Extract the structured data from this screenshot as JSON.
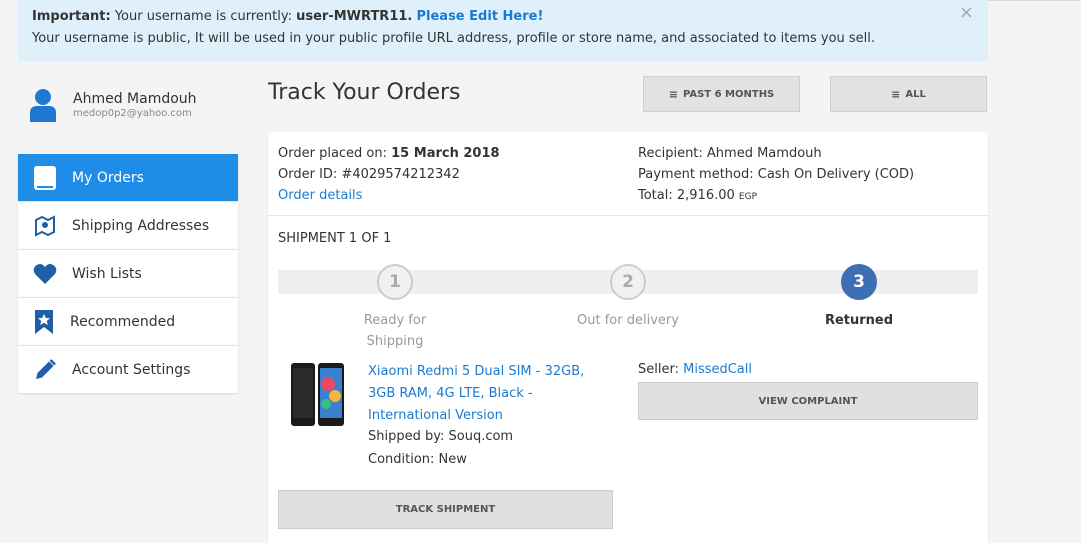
{
  "alert": {
    "important_label": "Important:",
    "text1": " Your username is currently: ",
    "username": "user-MWRTR11.",
    "edit_link": "Please Edit Here!",
    "line2": "Your username is public, It will be used in your public profile URL address, profile or store name, and associated to items you sell.",
    "close_symbol": "×"
  },
  "user": {
    "name": "Ahmed Mamdouh",
    "email": "medop0p2@yahoo.com",
    "avatar_icon": "user-icon"
  },
  "sidebar": {
    "items": [
      {
        "label": "My Orders",
        "icon": "book-icon",
        "active": true
      },
      {
        "label": "Shipping Addresses",
        "icon": "map-icon",
        "active": false
      },
      {
        "label": "Wish Lists",
        "icon": "heart-icon",
        "active": false
      },
      {
        "label": "Recommended",
        "icon": "bookmark-star-icon",
        "active": false
      },
      {
        "label": "Account Settings",
        "icon": "pencil-icon",
        "active": false
      }
    ]
  },
  "main": {
    "title": "Track Your Orders",
    "filters": {
      "past_label": "PAST 6 MONTHS",
      "all_label": "ALL",
      "bars": "≡"
    }
  },
  "order": {
    "placed_label": "Order placed on: ",
    "placed_date": "15 March 2018",
    "id_label": "Order ID: #4029574212342",
    "details_link": "Order details",
    "recipient": "Recipient: Ahmed Mamdouh",
    "payment": "Payment method: Cash On Delivery (COD)",
    "total_label": "Total: 2,916.00",
    "currency": "EGP",
    "shipment_label": "SHIPMENT 1 OF 1",
    "steps": [
      {
        "number": "1",
        "label_line1": "Ready for",
        "label_line2": "Shipping",
        "state": "todo"
      },
      {
        "number": "2",
        "label_line1": "Out for delivery",
        "label_line2": "",
        "state": "todo"
      },
      {
        "number": "3",
        "label_line1": "Returned",
        "label_line2": "",
        "state": "done"
      }
    ],
    "product": {
      "title_line1": "Xiaomi Redmi 5 Dual SIM - 32GB,",
      "title_line2": "3GB RAM, 4G LTE, Black -",
      "title_line3": "International Version",
      "shipped_by": "Shipped by: Souq.com",
      "condition": "Condition: New"
    },
    "seller_label": "Seller: ",
    "seller_name": "MissedCall",
    "view_complaint": "VIEW COMPLAINT",
    "track_shipment": "TRACK SHIPMENT"
  },
  "colors": {
    "accent": "#1f8de8",
    "link": "#1a7bd0",
    "step_done": "#3e6fb4",
    "alert_bg": "#dff0fb"
  }
}
